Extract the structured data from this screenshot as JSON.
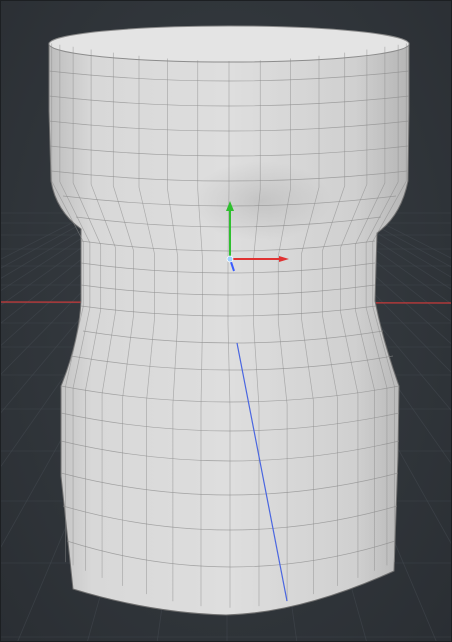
{
  "viewport": {
    "background_color": "#2f3338",
    "grid_color": "#454b52",
    "axis_x_color": "#d23a3a",
    "axis_z_color": "#3b5bd6",
    "mesh_color": "#d9d9d9",
    "wire_color": "#8a8a8a"
  },
  "gizmo": {
    "x_axis_color": "#e03232",
    "y_axis_color": "#2fbf2f",
    "z_axis_color": "#3a5cff",
    "icon": "transform-gizmo-icon"
  },
  "object": {
    "type": "mesh",
    "shape": "lathe-cylinder",
    "icon": "cylinder-mesh-icon"
  }
}
